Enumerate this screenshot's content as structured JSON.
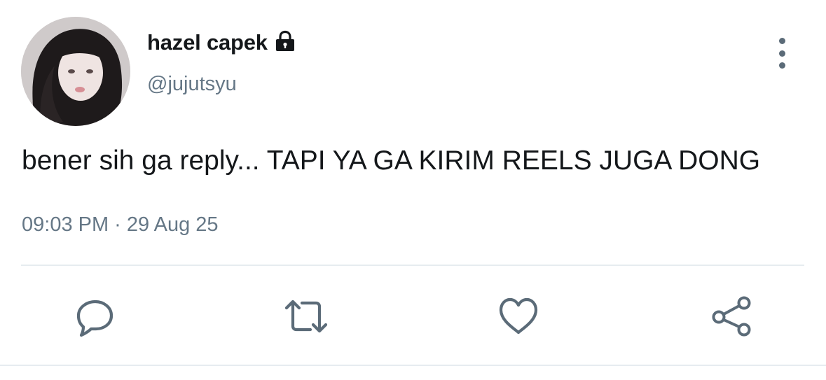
{
  "tweet": {
    "display_name": "hazel capek",
    "username": "@jujutsyu",
    "text": "bener sih ga reply... TAPI YA GA KIRIM REELS JUGA DONG",
    "timestamp": "09:03 PM · 29 Aug 25"
  },
  "icons": {
    "account": "lock-icon",
    "more": "more-vertical-icon",
    "actions": [
      "reply-icon",
      "retweet-icon",
      "like-icon",
      "share-icon"
    ]
  },
  "colors": {
    "text_primary": "#14171a",
    "text_secondary": "#657786",
    "icon": "#5b6b78",
    "divider": "#e6ecf0"
  }
}
